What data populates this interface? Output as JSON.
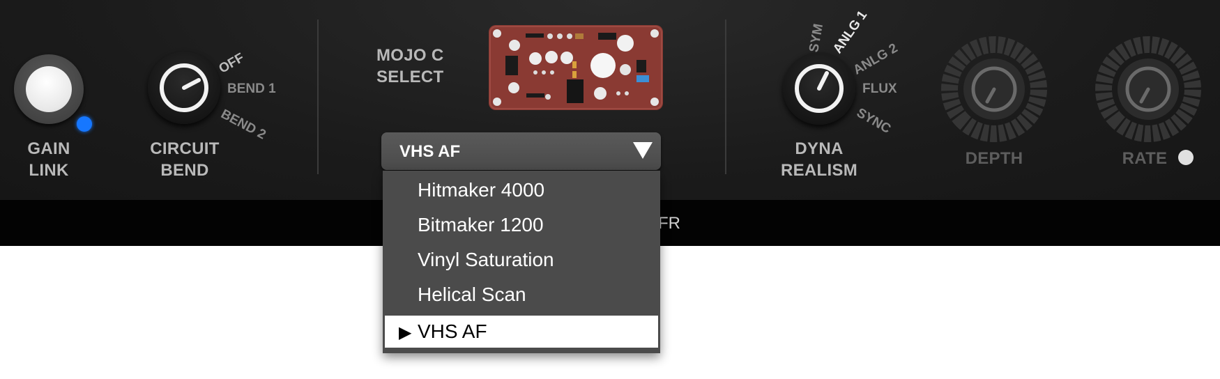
{
  "controls": {
    "gain_link": {
      "line1": "GAIN",
      "line2": "LINK"
    },
    "circuit_bend": {
      "line1": "CIRCUIT",
      "line2": "BEND",
      "positions": [
        "OFF",
        "BEND 1",
        "BEND 2"
      ]
    },
    "mojo": {
      "line1": "MOJO C",
      "line2": "SELECT",
      "selected": "VHS AF"
    },
    "dyna_realism": {
      "line1": "DYNA",
      "line2": "REALISM",
      "positions": [
        "SYM",
        "ANLG 1",
        "ANLG 2",
        "FLUX",
        "SYNC"
      ]
    },
    "depth": {
      "label": "DEPTH"
    },
    "rate": {
      "label": "RATE"
    }
  },
  "colors": {
    "gain_link_led": "#1677ff",
    "rate_led": "#e0e0e0",
    "pcb": "#8a3a33"
  },
  "menu": {
    "items": [
      {
        "label": "Hitmaker 4000",
        "selected": false
      },
      {
        "label": "Bitmaker 1200",
        "selected": false
      },
      {
        "label": "Vinyl Saturation",
        "selected": false
      },
      {
        "label": "Helical Scan",
        "selected": false
      },
      {
        "label": "VHS AF",
        "selected": true
      }
    ],
    "selected_marker": "▶"
  },
  "strip": {
    "partial_text": "FR"
  }
}
